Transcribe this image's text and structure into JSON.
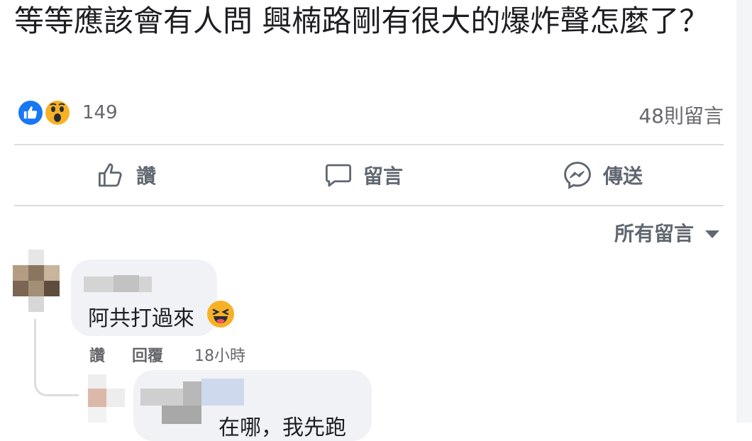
{
  "post": {
    "text": "等等應該會有人問 興楠路剛有很大的爆炸聲怎麼了？"
  },
  "reactions": {
    "types": [
      "like-icon",
      "wow-icon"
    ],
    "count": "149",
    "comments_count": "48則留言"
  },
  "actions": {
    "like_label": "讚",
    "comment_label": "留言",
    "share_label": "傳送"
  },
  "sort": {
    "label": "所有留言"
  },
  "comments": [
    {
      "text": "阿共打過來",
      "emoji": "laughing-emoji-icon",
      "like": "讚",
      "reply": "回覆",
      "time": "18小時"
    }
  ],
  "reply_preview": {
    "text": "在哪，我先跑"
  },
  "colors": {
    "accent": "#1877f2",
    "text": "#1c1e21",
    "muted": "#65676b",
    "bubble": "#f0f2f5",
    "divider": "#dadde1"
  }
}
